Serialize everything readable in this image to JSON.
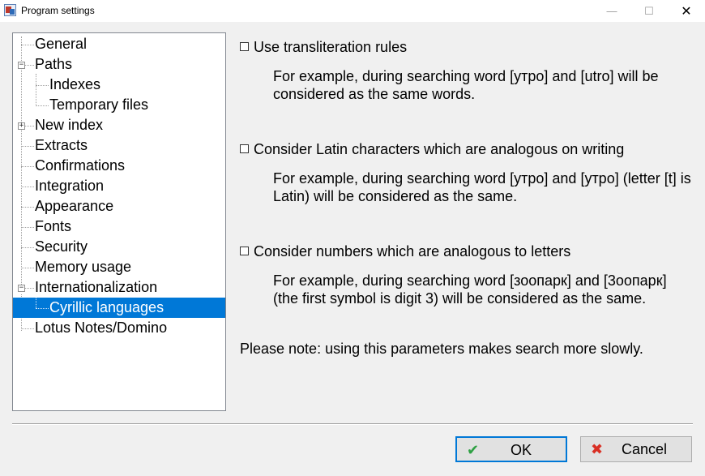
{
  "window": {
    "title": "Program settings",
    "minimize": "—",
    "maximize": "☐",
    "close": "✕"
  },
  "tree": {
    "items": [
      {
        "label": "General"
      },
      {
        "label": "Paths",
        "expander": "−"
      },
      {
        "label": "Indexes"
      },
      {
        "label": "Temporary files"
      },
      {
        "label": "New index",
        "expander": "+"
      },
      {
        "label": "Extracts"
      },
      {
        "label": "Confirmations"
      },
      {
        "label": "Integration"
      },
      {
        "label": "Appearance"
      },
      {
        "label": "Fonts"
      },
      {
        "label": "Security"
      },
      {
        "label": "Memory usage"
      },
      {
        "label": "Internationalization",
        "expander": "−"
      },
      {
        "label": "Cyrillic languages",
        "selected": true
      },
      {
        "label": "Lotus Notes/Domino"
      }
    ]
  },
  "options": [
    {
      "label": "Use transliteration rules",
      "checked": false,
      "description": "For example, during searching word [утро] and [utro] will be considered as the same words."
    },
    {
      "label": "Consider Latin characters which are analogous on writing",
      "checked": false,
      "description": "For example, during searching word [утро] and [yтро] (letter [t] is Latin) will be considered as the same."
    },
    {
      "label": "Consider numbers which are analogous to letters",
      "checked": false,
      "description": "For example, during searching word [зоопарк] and [3оопарк] (the first symbol is digit 3) will be considered as the same."
    }
  ],
  "note": "Please note: using this parameters makes search more slowly.",
  "buttons": {
    "ok": "OK",
    "cancel": "Cancel",
    "ok_icon": "✔",
    "cancel_icon": "✖"
  },
  "colors": {
    "selection": "#0078d7",
    "ok_icon": "#2ea043",
    "cancel_icon": "#d93025"
  }
}
